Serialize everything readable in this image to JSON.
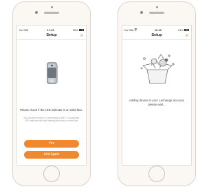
{
  "left_phone": {
    "status": {
      "carrier": "No SIM",
      "time": "17:26",
      "battery": "56%"
    },
    "nav": {
      "title": "Setup",
      "close_glyph": "×"
    },
    "message_main": "Please check if the LED indicator is on solid blue.",
    "message_sub": "Your doorbell device is connecting to WiFi. If successful, LED indicator will stop flashing and stay on solid blue.",
    "buttons": {
      "yes": "Yes",
      "add_again": "Add Again"
    },
    "battery_level": 0.56
  },
  "right_phone": {
    "status": {
      "carrier": "No SIM",
      "time": "11:15",
      "battery": "24%"
    },
    "nav": {
      "title": "Setup",
      "close_glyph": "×"
    },
    "message": "Adding device to your Lechange account, please wait...",
    "battery_level": 0.24
  },
  "colors": {
    "accent": "#f0892e",
    "phone_body": "#fbf8f3"
  },
  "icons": [
    "wifi-icon",
    "battery-icon",
    "close-icon",
    "doorbell-device-icon",
    "box-illustration-icon",
    "home-button-icon"
  ]
}
